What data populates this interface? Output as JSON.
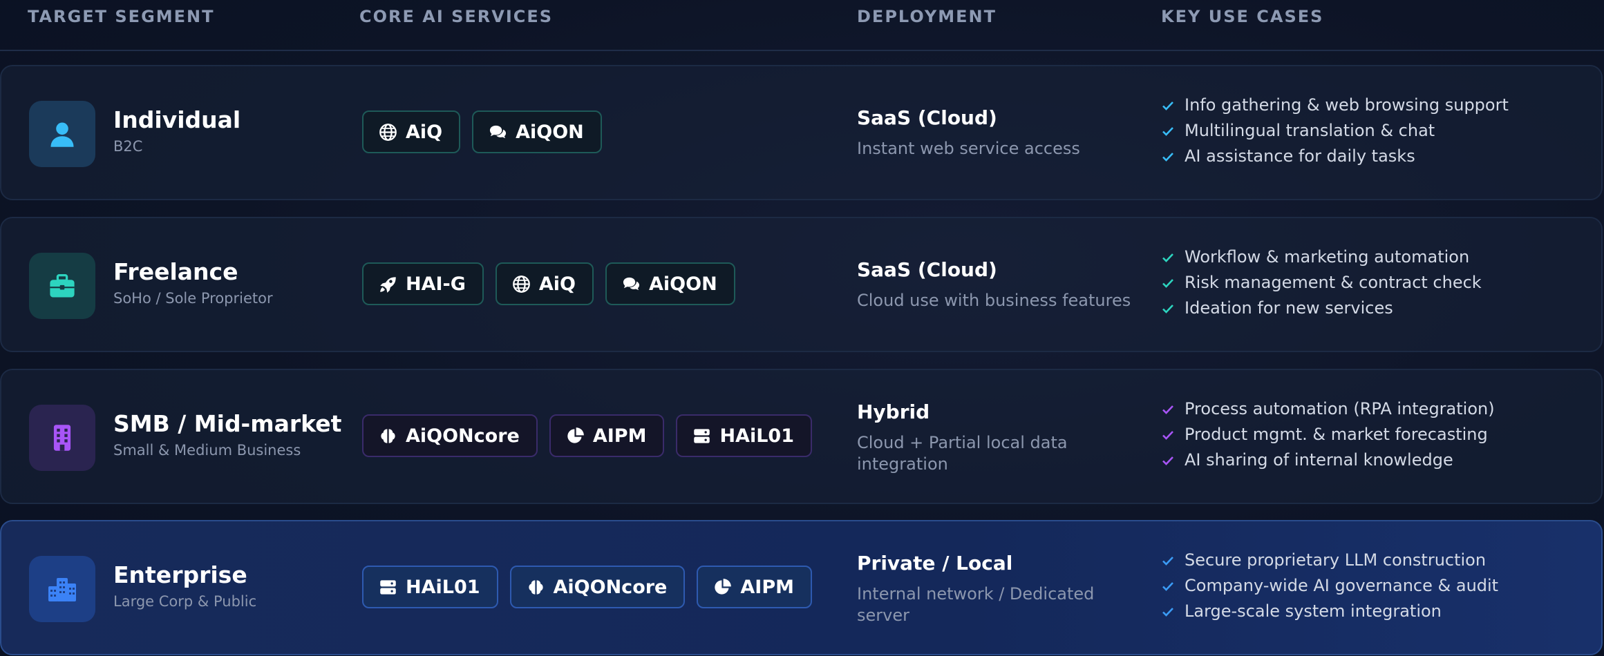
{
  "colors": {
    "teal": "#2dd4bf",
    "blue": "#38bdf8",
    "purple": "#a855f7",
    "enterprise_blue": "#3b82f6"
  },
  "header": {
    "segment": "TARGET SEGMENT",
    "services": "CORE AI SERVICES",
    "deployment": "DEPLOYMENT",
    "use_cases": "KEY USE CASES"
  },
  "rows": [
    {
      "icon": "user-icon",
      "title": "Individual",
      "subtitle": "B2C",
      "services": [
        {
          "icon": "globe-icon",
          "label": "AiQ"
        },
        {
          "icon": "chat-bubbles-icon",
          "label": "AiQON"
        }
      ],
      "deployment": {
        "title": "SaaS (Cloud)",
        "desc": "Instant web service access"
      },
      "use_cases": [
        "Info gathering & web browsing support",
        "Multilingual translation & chat",
        "AI assistance for daily tasks"
      ]
    },
    {
      "icon": "briefcase-icon",
      "title": "Freelance",
      "subtitle": "SoHo / Sole Proprietor",
      "services": [
        {
          "icon": "rocket-icon",
          "label": "HAI-G"
        },
        {
          "icon": "globe-icon",
          "label": "AiQ"
        },
        {
          "icon": "chat-bubbles-icon",
          "label": "AiQON"
        }
      ],
      "deployment": {
        "title": "SaaS (Cloud)",
        "desc": "Cloud use with business features"
      },
      "use_cases": [
        "Workflow & marketing automation",
        "Risk management & contract check",
        "Ideation for new services"
      ]
    },
    {
      "icon": "building-icon",
      "title": "SMB / Mid-market",
      "subtitle": "Small & Medium Business",
      "services": [
        {
          "icon": "brain-icon",
          "label": "AiQONcore"
        },
        {
          "icon": "pie-chart-icon",
          "label": "AIPM"
        },
        {
          "icon": "server-icon",
          "label": "HAiL01"
        }
      ],
      "deployment": {
        "title": "Hybrid",
        "desc": "Cloud + Partial local data integration"
      },
      "use_cases": [
        "Process automation (RPA integration)",
        "Product mgmt. & market forecasting",
        "AI sharing of internal knowledge"
      ]
    },
    {
      "icon": "city-icon",
      "title": "Enterprise",
      "subtitle": "Large Corp & Public",
      "services": [
        {
          "icon": "server-icon",
          "label": "HAiL01"
        },
        {
          "icon": "brain-icon",
          "label": "AiQONcore"
        },
        {
          "icon": "pie-chart-icon",
          "label": "AIPM"
        }
      ],
      "deployment": {
        "title": "Private / Local",
        "desc": "Internal network / Dedicated server"
      },
      "use_cases": [
        "Secure proprietary LLM construction",
        "Company-wide AI governance & audit",
        "Large-scale system integration"
      ]
    }
  ]
}
